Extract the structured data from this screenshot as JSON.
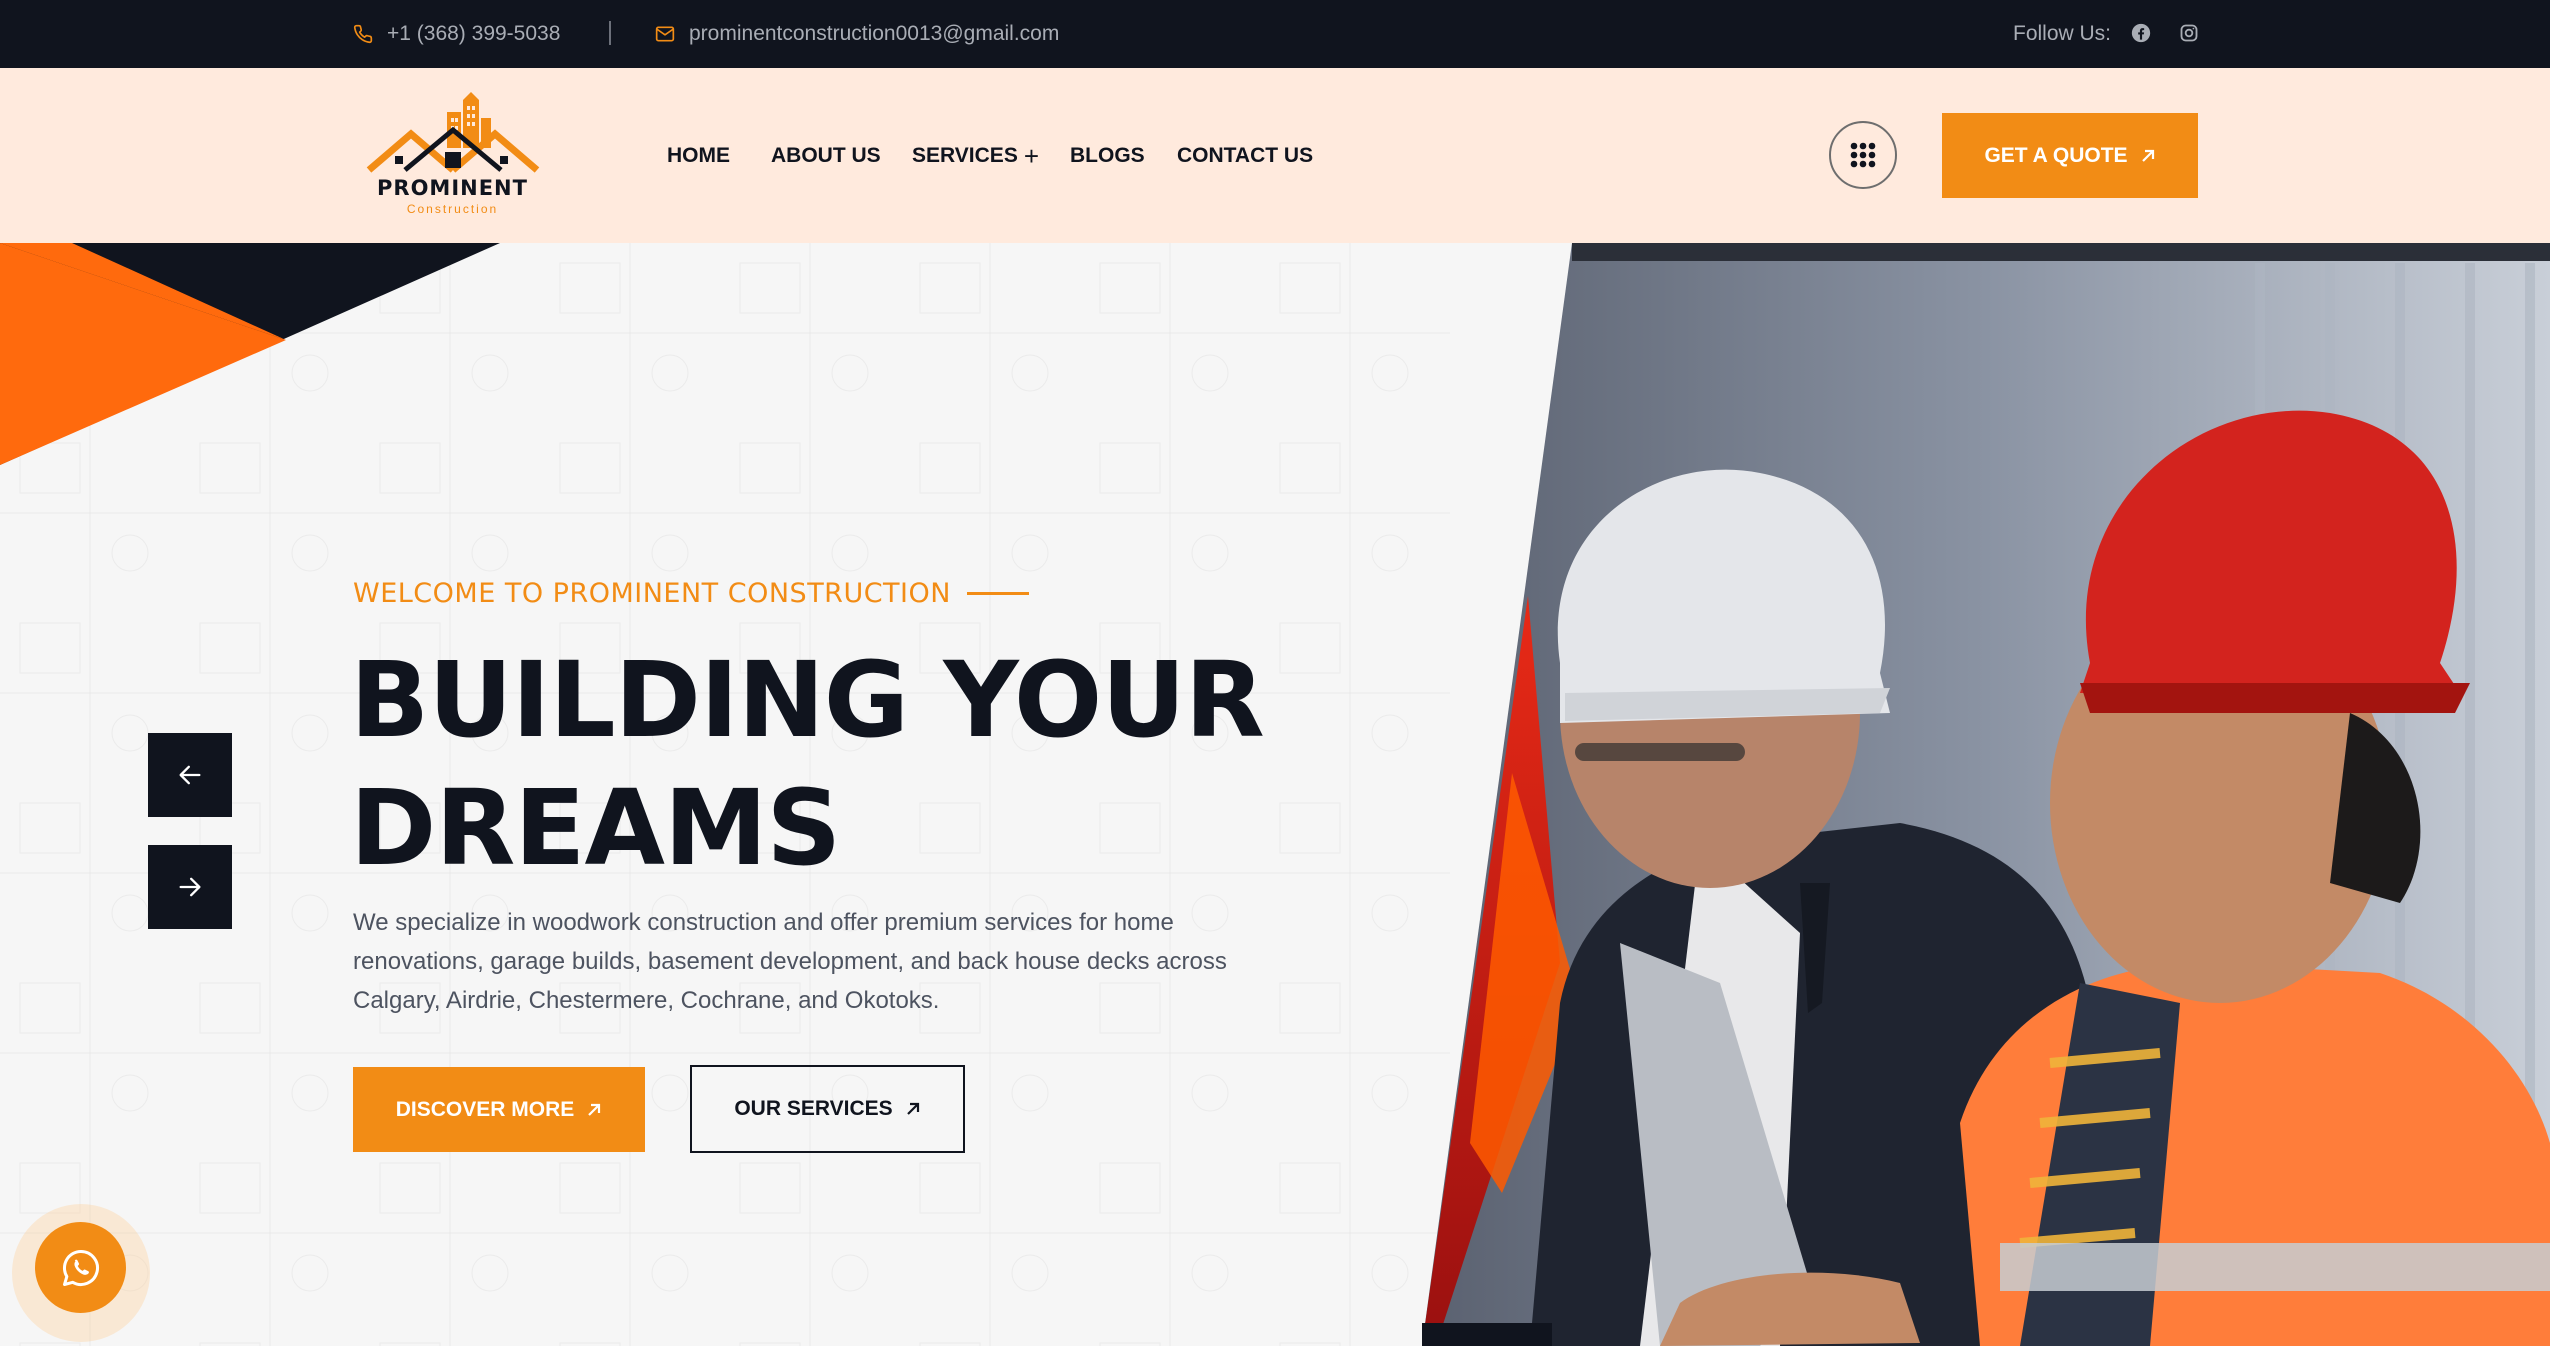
{
  "topbar": {
    "phone": "+1 (368) 399-5038",
    "email": "prominentconstruction0013@gmail.com",
    "follow_label": "Follow Us:",
    "social": [
      {
        "name": "facebook-icon"
      },
      {
        "name": "instagram-icon"
      }
    ]
  },
  "header": {
    "logo": {
      "title": "PROMINENT",
      "subtitle": "Construction"
    },
    "nav": [
      {
        "label": "HOME"
      },
      {
        "label": "ABOUT US"
      },
      {
        "label": "SERVICES"
      },
      {
        "label": "BLOGS"
      },
      {
        "label": "CONTACT US"
      }
    ],
    "quote_button": "GET A QUOTE"
  },
  "hero": {
    "eyebrow": "WELCOME TO PROMINENT CONSTRUCTION",
    "headline_line1": "BUILDING YOUR",
    "headline_line2": "DREAMS",
    "intro": "We specialize in woodwork construction and offer premium services for home renovations, garage builds, basement development, and back house decks across Calgary, Airdrie, Chestermere, Cochrane, and Okotoks.",
    "primary_button": "DISCOVER MORE",
    "secondary_button": "OUR SERVICES"
  },
  "colors": {
    "accent": "#f28c15",
    "dark": "#10141e",
    "header_bg": "#ffeadd",
    "hero_bg": "#f6f6f6",
    "text_muted": "#4d5360"
  }
}
